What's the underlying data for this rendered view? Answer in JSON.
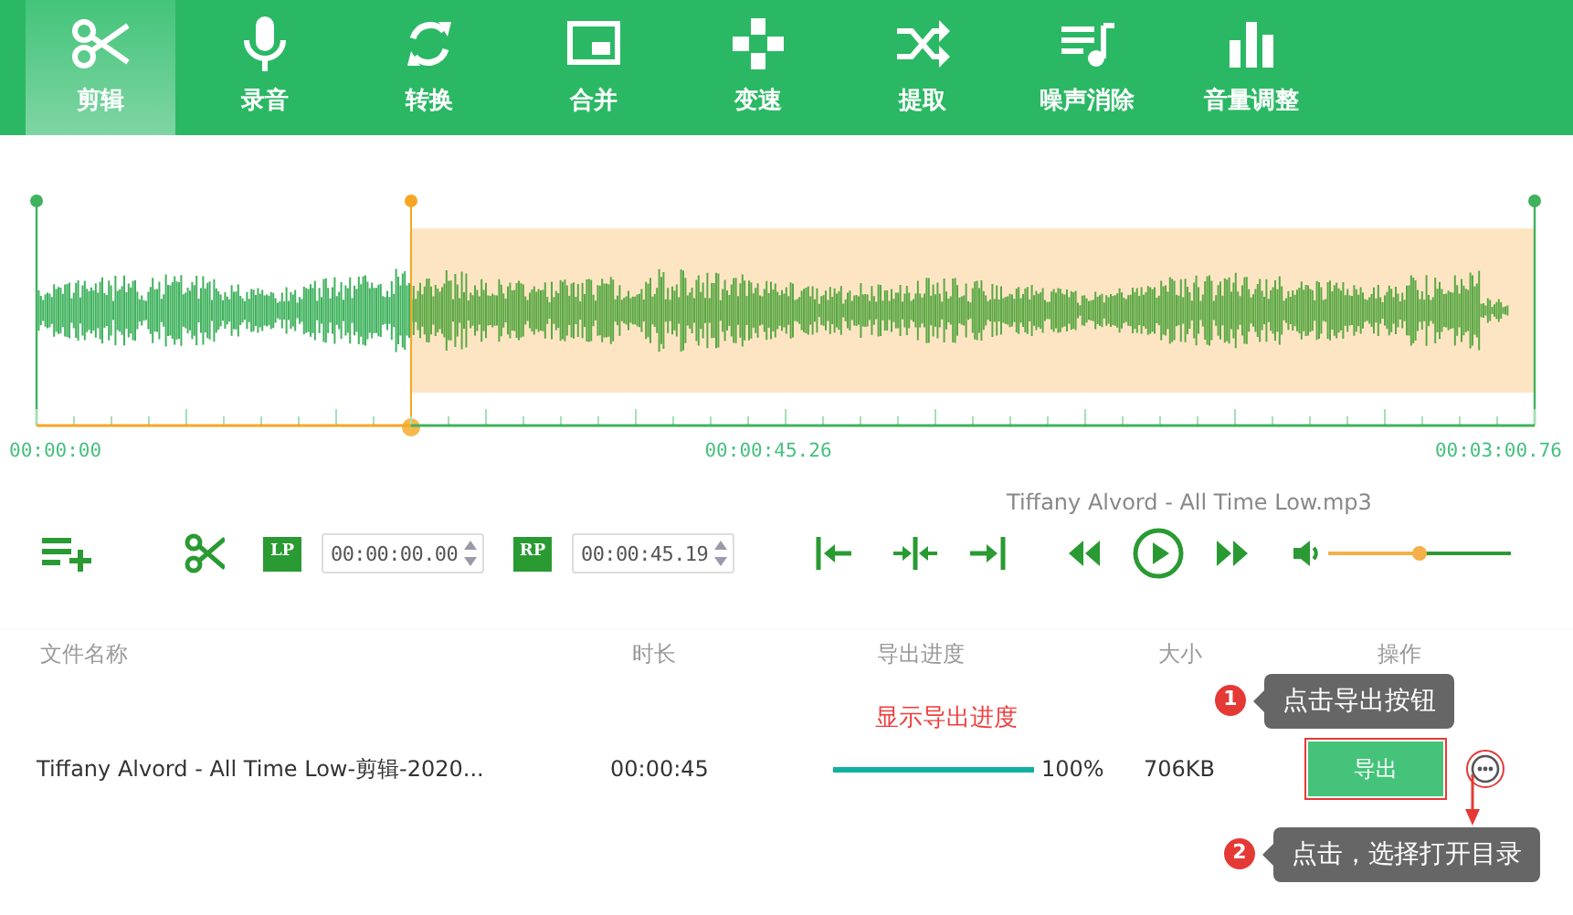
{
  "tabs": [
    {
      "label": "剪辑",
      "selected": true
    },
    {
      "label": "录音",
      "selected": false
    },
    {
      "label": "转换",
      "selected": false
    },
    {
      "label": "合并",
      "selected": false
    },
    {
      "label": "变速",
      "selected": false
    },
    {
      "label": "提取",
      "selected": false
    },
    {
      "label": "噪声消除",
      "selected": false
    },
    {
      "label": "音量调整",
      "selected": false
    }
  ],
  "editor": {
    "trim_handle": {
      "level": 0.25
    },
    "time_labels": [
      "00:00:00",
      "00:00:45.26",
      "00:03:00.76"
    ],
    "file_name": "Tiffany Alvord - All Time Low.mp3",
    "start": {
      "badge": "LP",
      "value": "00:00:00.00"
    },
    "end": {
      "badge": "RP",
      "value": "00:00:45.19"
    },
    "volume": {
      "level": 0.5
    }
  },
  "table": {
    "columns": [
      "文件名称",
      "时长",
      "导出进度",
      "大小",
      "操作"
    ],
    "rows": [
      {
        "name": "Tiffany Alvord - All Time Low-剪辑-2020...",
        "duration": "00:00:45",
        "progress": {
          "level": 1.0,
          "reading": "100%"
        },
        "size": "706KB",
        "export_label": "导出",
        "export_highlighted": true,
        "more_highlighted": true
      }
    ]
  },
  "annotations": [
    {
      "kind": "note",
      "text": "显示导出进度"
    },
    {
      "kind": "tip",
      "number": "1",
      "text": "点击导出按钮"
    },
    {
      "kind": "tip",
      "number": "2",
      "text": "点击，选择打开目录"
    }
  ]
}
